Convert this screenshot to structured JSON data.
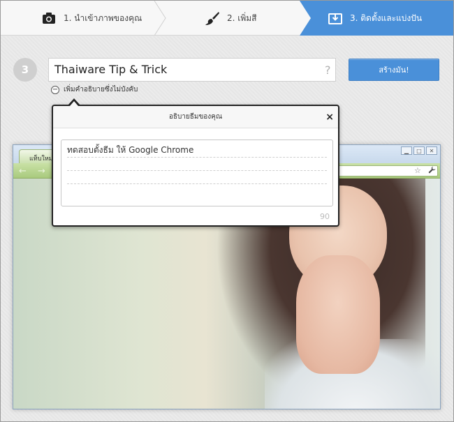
{
  "steps": [
    {
      "label": "1. นำเข้าภาพของคุณ",
      "icon": "camera-icon"
    },
    {
      "label": "2. เพิ่มสี",
      "icon": "brush-icon"
    },
    {
      "label": "3. ติดตั้งและแบ่งปัน",
      "icon": "download-box-icon",
      "active": true
    }
  ],
  "form": {
    "step_number": "3",
    "theme_name": "Thaiware Tip & Trick",
    "help": "?",
    "create_label": "สร้างมัน!",
    "desc_toggle_label": "เพิ่มคำอธิบายซึ่งไม่บังคับ"
  },
  "popup": {
    "title": "อธิบายธีมของคุณ",
    "close": "×",
    "lines": [
      "ทดสอบตั้งธีม ให้ Google Chrome",
      "",
      ""
    ],
    "char_count": "90"
  },
  "browser": {
    "tab_label": "แท็บใหม่",
    "win_buttons": [
      "▁",
      "□",
      "✕"
    ],
    "nav": "← →",
    "star": "☆",
    "wrench": "🔧"
  },
  "colors": {
    "accent": "#4a90d9",
    "tab_green": "#c7dea8"
  }
}
